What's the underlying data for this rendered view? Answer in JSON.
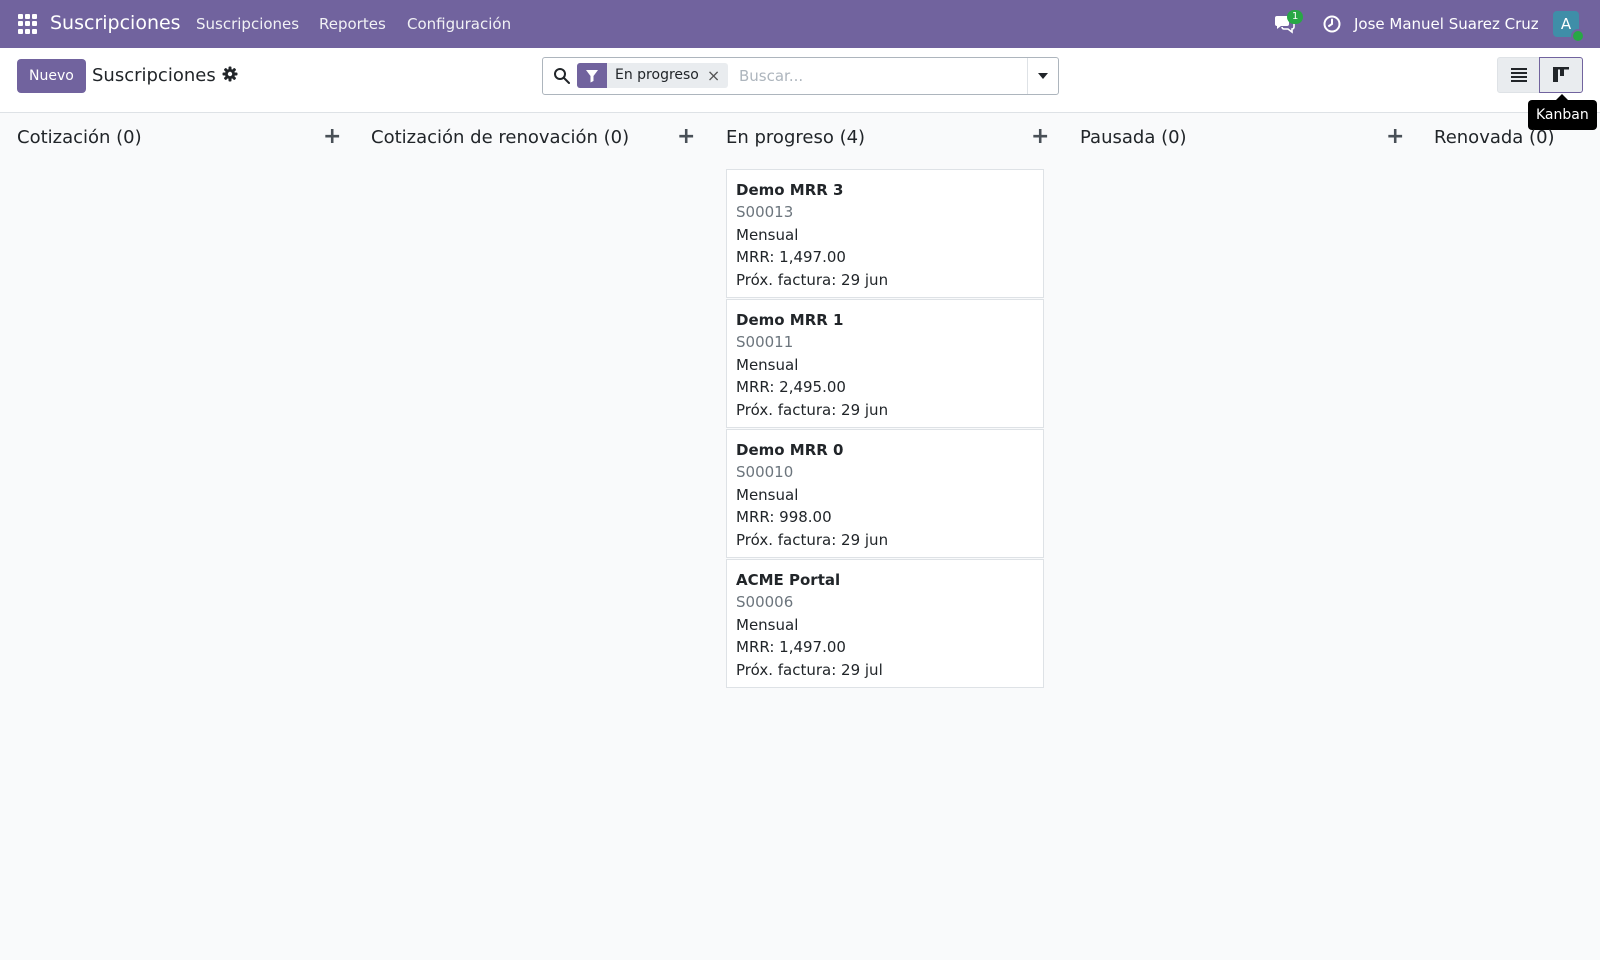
{
  "navbar": {
    "brand": "Suscripciones",
    "menu": [
      "Suscripciones",
      "Reportes",
      "Configuración"
    ],
    "chat_badge": "1",
    "user_name": "Jose Manuel Suarez Cruz",
    "avatar_letter": "A"
  },
  "control": {
    "new_button": "Nuevo",
    "title": "Suscripciones",
    "search": {
      "facet": "En progreso",
      "facet_close": "×",
      "placeholder": "Buscar..."
    },
    "tooltip": "Kanban"
  },
  "columns": [
    {
      "title": "Cotización (0)"
    },
    {
      "title": "Cotización de renovación (0)"
    },
    {
      "title": "En progreso (4)"
    },
    {
      "title": "Pausada (0)"
    },
    {
      "title": "Renovada (0)"
    }
  ],
  "cards": [
    {
      "name": "Demo MRR 3",
      "ref": "S00013",
      "plan": "Mensual",
      "mrr": "MRR: 1,497.00",
      "next_invoice": "Próx. factura: 29 jun"
    },
    {
      "name": "Demo MRR 1",
      "ref": "S00011",
      "plan": "Mensual",
      "mrr": "MRR: 2,495.00",
      "next_invoice": "Próx. factura: 29 jun"
    },
    {
      "name": "Demo MRR 0",
      "ref": "S00010",
      "plan": "Mensual",
      "mrr": "MRR: 998.00",
      "next_invoice": "Próx. factura: 29 jun"
    },
    {
      "name": "ACME Portal",
      "ref": "S00006",
      "plan": "Mensual",
      "mrr": "MRR: 1,497.00",
      "next_invoice": "Próx. factura: 29 jul"
    }
  ],
  "colors": {
    "brand": "#71639e",
    "badge": "#28a745",
    "avatar": "#3f8ea8"
  }
}
